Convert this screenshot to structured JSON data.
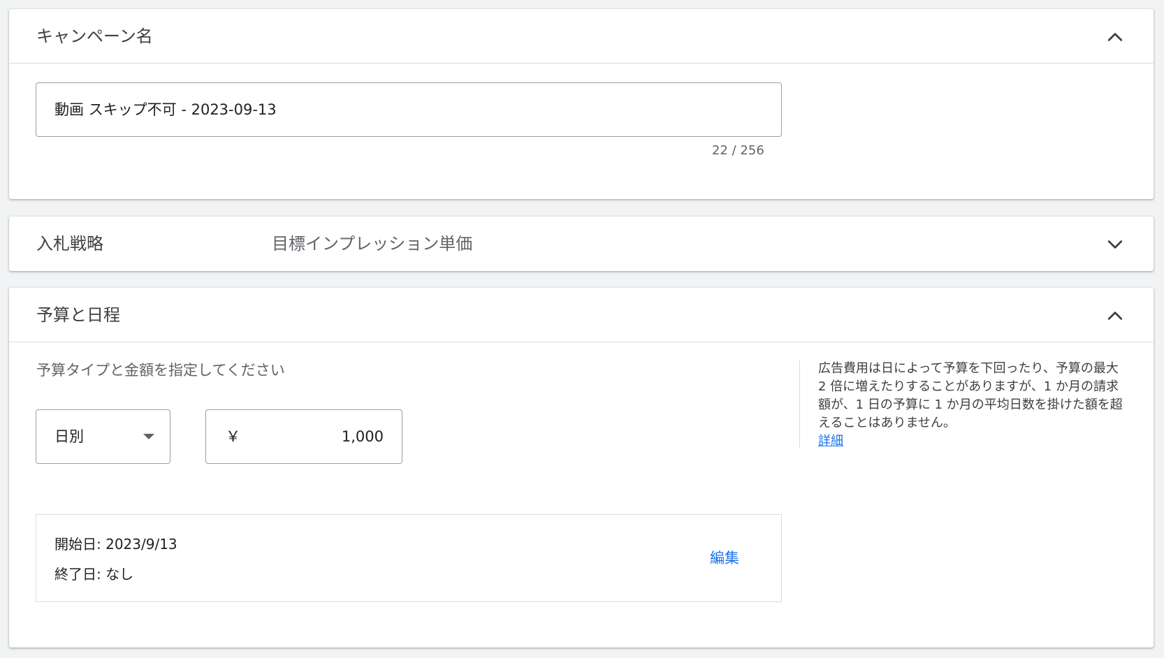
{
  "campaign_name": {
    "title": "キャンペーン名",
    "input_value": "動画 スキップ不可 - 2023-09-13",
    "char_count": "22 / 256",
    "toggle_icon": "chevron-up-icon"
  },
  "bid_strategy": {
    "title": "入札戦略",
    "value": "目標インプレッション単価",
    "toggle_icon": "chevron-down-icon"
  },
  "budget_schedule": {
    "title": "予算と日程",
    "prompt": "予算タイプと金額を指定してください",
    "budget_type": "日別",
    "currency_symbol": "￥",
    "amount": "1,000",
    "info_text": "広告費用は日によって予算を下回ったり、予算の最大 2 倍に増えたりすることがありますが、1 か月の請求額が、1 日の予算に 1 か月の平均日数を掛けた額を超えることはありません。",
    "info_link": "詳細",
    "start_date": "開始日: 2023/9/13",
    "end_date": "終了日: なし",
    "edit_label": "編集",
    "toggle_icon": "chevron-up-icon"
  },
  "colors": {
    "accent": "#1a73e8",
    "background": "#f1f3f4",
    "card": "#ffffff",
    "border": "#dadce0"
  }
}
